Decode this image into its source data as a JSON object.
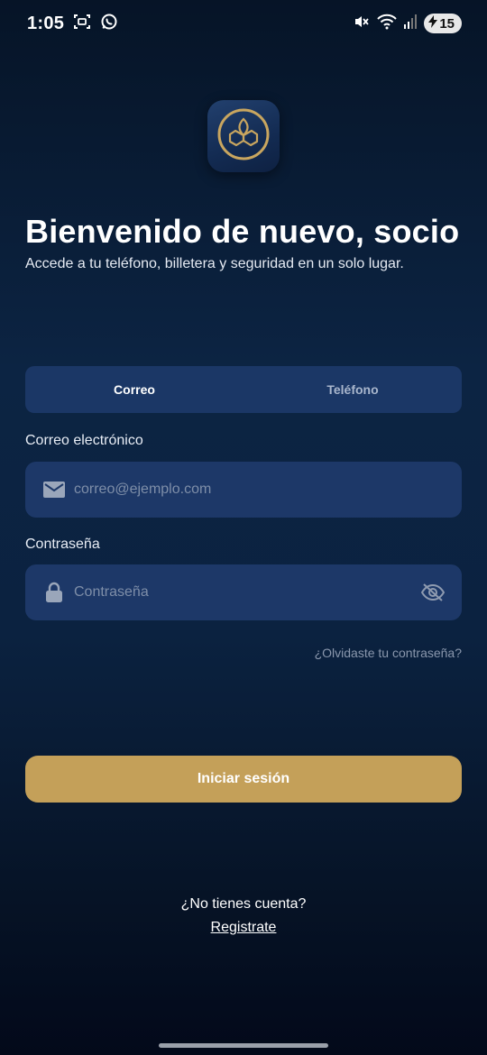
{
  "status_bar": {
    "time": "1:05",
    "battery_level": "15",
    "left_icons": [
      "screenshot-icon",
      "whatsapp-icon"
    ],
    "right_icons": [
      "mute-icon",
      "wifi-icon",
      "signal-icon",
      "battery-charging-icon"
    ]
  },
  "logo": {
    "icon": "app-logo-icon",
    "accent_color": "#c9a65f"
  },
  "welcome": {
    "title": "Bienvenido de nuevo, socio",
    "subtitle": "Accede a tu teléfono, billetera y seguridad en un solo lugar."
  },
  "tabs": [
    {
      "label": "Correo",
      "active": true
    },
    {
      "label": "Teléfono",
      "active": false
    }
  ],
  "email_field": {
    "label": "Correo electrónico",
    "placeholder": "correo@ejemplo.com",
    "value": "",
    "icon": "mail-icon"
  },
  "password_field": {
    "label": "Contraseña",
    "placeholder": "Contraseña",
    "value": "",
    "icon": "lock-icon",
    "toggle_icon": "eye-off-icon"
  },
  "forgot_password": "¿Olvidaste tu contraseña?",
  "login_button": {
    "label": "Iniciar sesión",
    "color": "#c4a059"
  },
  "signup": {
    "prompt": "¿No tienes cuenta?",
    "link": "Registrate"
  },
  "colors": {
    "background_top": "#061427",
    "background_mid": "#0c2443",
    "field_background": "#1d3868",
    "accent": "#c4a059"
  }
}
